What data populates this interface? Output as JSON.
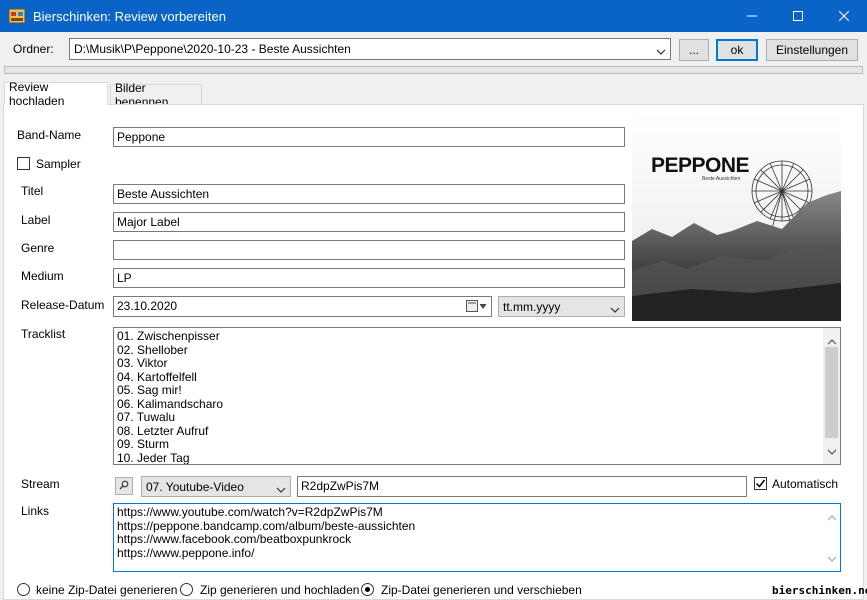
{
  "window": {
    "title": "Bierschinken: Review vorbereiten",
    "accent": "#0a64c8"
  },
  "toolbar": {
    "folder_label": "Ordner:",
    "folder_value": "D:\\Musik\\P\\Peppone\\2020-10-23 - Beste Aussichten",
    "browse_label": "...",
    "ok_label": "ok",
    "settings_label": "Einstellungen"
  },
  "tabs": [
    {
      "label": "Review hochladen"
    },
    {
      "label": "Bilder benennen"
    }
  ],
  "form": {
    "band_label": "Band-Name",
    "band_value": "Peppone",
    "sampler_label": "Sampler",
    "title_label": "Titel",
    "title_value": "Beste Aussichten",
    "label_label": "Label",
    "label_value": "Major Label",
    "genre_label": "Genre",
    "genre_value": "",
    "medium_label": "Medium",
    "medium_value": "LP",
    "release_label": "Release-Datum",
    "release_value": "23.10.2020",
    "date_format_value": "tt.mm.yyyy",
    "tracklist_label": "Tracklist",
    "stream_label": "Stream",
    "stream_track_value": "07. Youtube-Video",
    "stream_id_value": "R2dpZwPis7M",
    "auto_label": "Automatisch",
    "links_label": "Links"
  },
  "tracklist": [
    "01. Zwischenpisser",
    "02. Shellober",
    "03. Viktor",
    "04. Kartoffelfell",
    "05. Sag mir!",
    "06. Kalimandscharo",
    "07. Tuwalu",
    "08. Letzter Aufruf",
    "09. Sturm",
    "10. Jeder Tag"
  ],
  "links": [
    "https://www.youtube.com/watch?v=R2dpZwPis7M",
    "https://peppone.bandcamp.com/album/beste-aussichten",
    "https://www.facebook.com/beatboxpunkrock",
    "https://www.peppone.info/"
  ],
  "zip_options": [
    {
      "label": "keine Zip-Datei generieren",
      "checked": false
    },
    {
      "label": "Zip generieren und hochladen",
      "checked": false
    },
    {
      "label": "Zip-Datei generieren und verschieben",
      "checked": true
    }
  ],
  "cover": {
    "band_text": "PEPPONE",
    "subtitle_text": "Beste Aussichten"
  },
  "watermark": "bierschinken.net"
}
